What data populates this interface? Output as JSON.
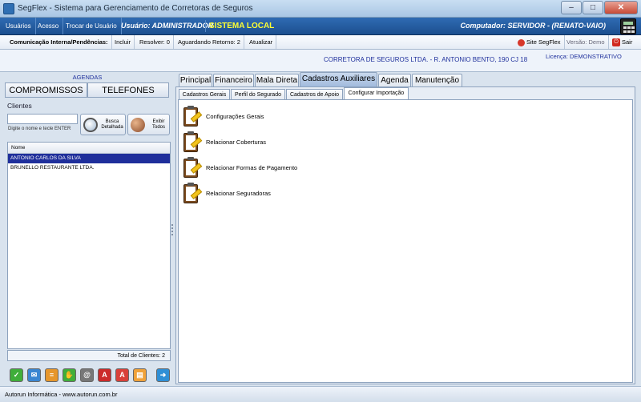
{
  "window": {
    "title": "SegFlex - Sistema para Gerenciamento de Corretoras de Seguros"
  },
  "menu": {
    "items": [
      "Usuários",
      "Acesso",
      "Trocar de Usuário"
    ],
    "user": "Usuário: ADMINISTRADOR",
    "local": "SISTEMA LOCAL",
    "computer": "Computador: SERVIDOR - (RENATO-VAIO)"
  },
  "toolbar": {
    "comm": "Comunicação Interna/Pendências:",
    "incluir": "Incluir",
    "resolver": "Resolver: 0",
    "aguardando": "Aguardando Retorno: 2",
    "atualizar": "Atualizar",
    "site": "Site SegFlex",
    "versao": "Versão: Demo",
    "sair": "Sair"
  },
  "company": {
    "name": "CORRETORA DE SEGUROS LTDA. - R. ANTONIO BENTO, 190 CJ 18",
    "license": "Licença: DEMONSTRATIVO"
  },
  "left": {
    "agendas": "AGENDAS",
    "compromissos": "COMPROMISSOS",
    "telefones": "TELEFONES",
    "clients_label": "Clientes",
    "search_hint": "Digite o nome e tecle ENTER",
    "busca": "Busca Detalhada",
    "exibir": "Exibir Todos",
    "grid_header": "Nome",
    "rows": [
      "ANTONIO CARLOS DA SILVA",
      "BRUNELLO RESTAURANTE LTDA."
    ],
    "total": "Total de Clientes: 2"
  },
  "tabs": [
    "Principal",
    "Financeiro",
    "Mala Direta",
    "Cadastros Auxiliares",
    "Agenda",
    "Manutenção"
  ],
  "subtabs": [
    "Cadastros Gerais",
    "Perfil do Segurado",
    "Cadastros de Apoio",
    "Configurar Importação"
  ],
  "config_items": [
    "Configurações Gerais",
    "Relacionar Coberturas",
    "Relacionar Formas de Pagamento",
    "Relacionar Seguradoras"
  ],
  "status": "Autorun Informática - www.autorun.com.br",
  "colors": {
    "menu_bg": "#1c4f8f",
    "selected_row": "#1f2f9b",
    "accent_text": "#1e2f9c",
    "local_text": "#ffff33"
  }
}
